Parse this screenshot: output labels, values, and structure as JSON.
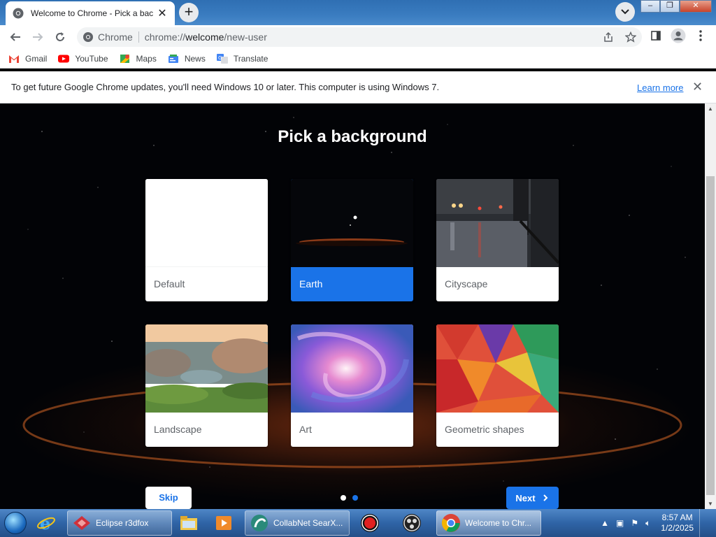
{
  "browser": {
    "tab_title": "Welcome to Chrome - Pick a bac",
    "tab_close": "✕",
    "new_tab": "+",
    "window_buttons": [
      "–",
      "❐",
      "✕"
    ]
  },
  "omnibox": {
    "chip": "Chrome",
    "url_prefix": "chrome://",
    "url_host": "welcome",
    "url_path": "/new-user"
  },
  "bookmarks": [
    {
      "label": "Gmail",
      "icon": "gmail-icon"
    },
    {
      "label": "YouTube",
      "icon": "youtube-icon"
    },
    {
      "label": "Maps",
      "icon": "maps-icon"
    },
    {
      "label": "News",
      "icon": "news-icon"
    },
    {
      "label": "Translate",
      "icon": "translate-icon"
    }
  ],
  "infobar": {
    "message": "To get future Google Chrome updates, you'll need Windows 10 or later. This computer is using Windows 7.",
    "link": "Learn more",
    "close": "✕"
  },
  "welcome": {
    "title": "Pick a background",
    "cards": [
      {
        "label": "Default",
        "selected": false
      },
      {
        "label": "Earth",
        "selected": true
      },
      {
        "label": "Cityscape",
        "selected": false
      },
      {
        "label": "Landscape",
        "selected": false
      },
      {
        "label": "Art",
        "selected": false
      },
      {
        "label": "Geometric shapes",
        "selected": false
      }
    ],
    "skip_label": "Skip",
    "next_label": "Next",
    "pager": {
      "pages": 2,
      "current": 2
    }
  },
  "taskbar": {
    "items": [
      {
        "label": "",
        "icon": "ie-icon"
      },
      {
        "label": "Eclipse r3dfox",
        "icon": "r3dfox-icon"
      },
      {
        "label": "",
        "icon": "folder-icon"
      },
      {
        "label": "",
        "icon": "media-player-icon"
      },
      {
        "label": "CollabNet SearX...",
        "icon": "collabnet-icon"
      },
      {
        "label": "",
        "icon": "record-icon"
      },
      {
        "label": "",
        "icon": "obs-icon"
      },
      {
        "label": "Welcome to Chr...",
        "icon": "chrome-icon"
      }
    ],
    "time": "8:57 AM",
    "date": "1/2/2025"
  },
  "colors": {
    "accent": "#1a73e8",
    "selected_card": "#1a73e8"
  }
}
